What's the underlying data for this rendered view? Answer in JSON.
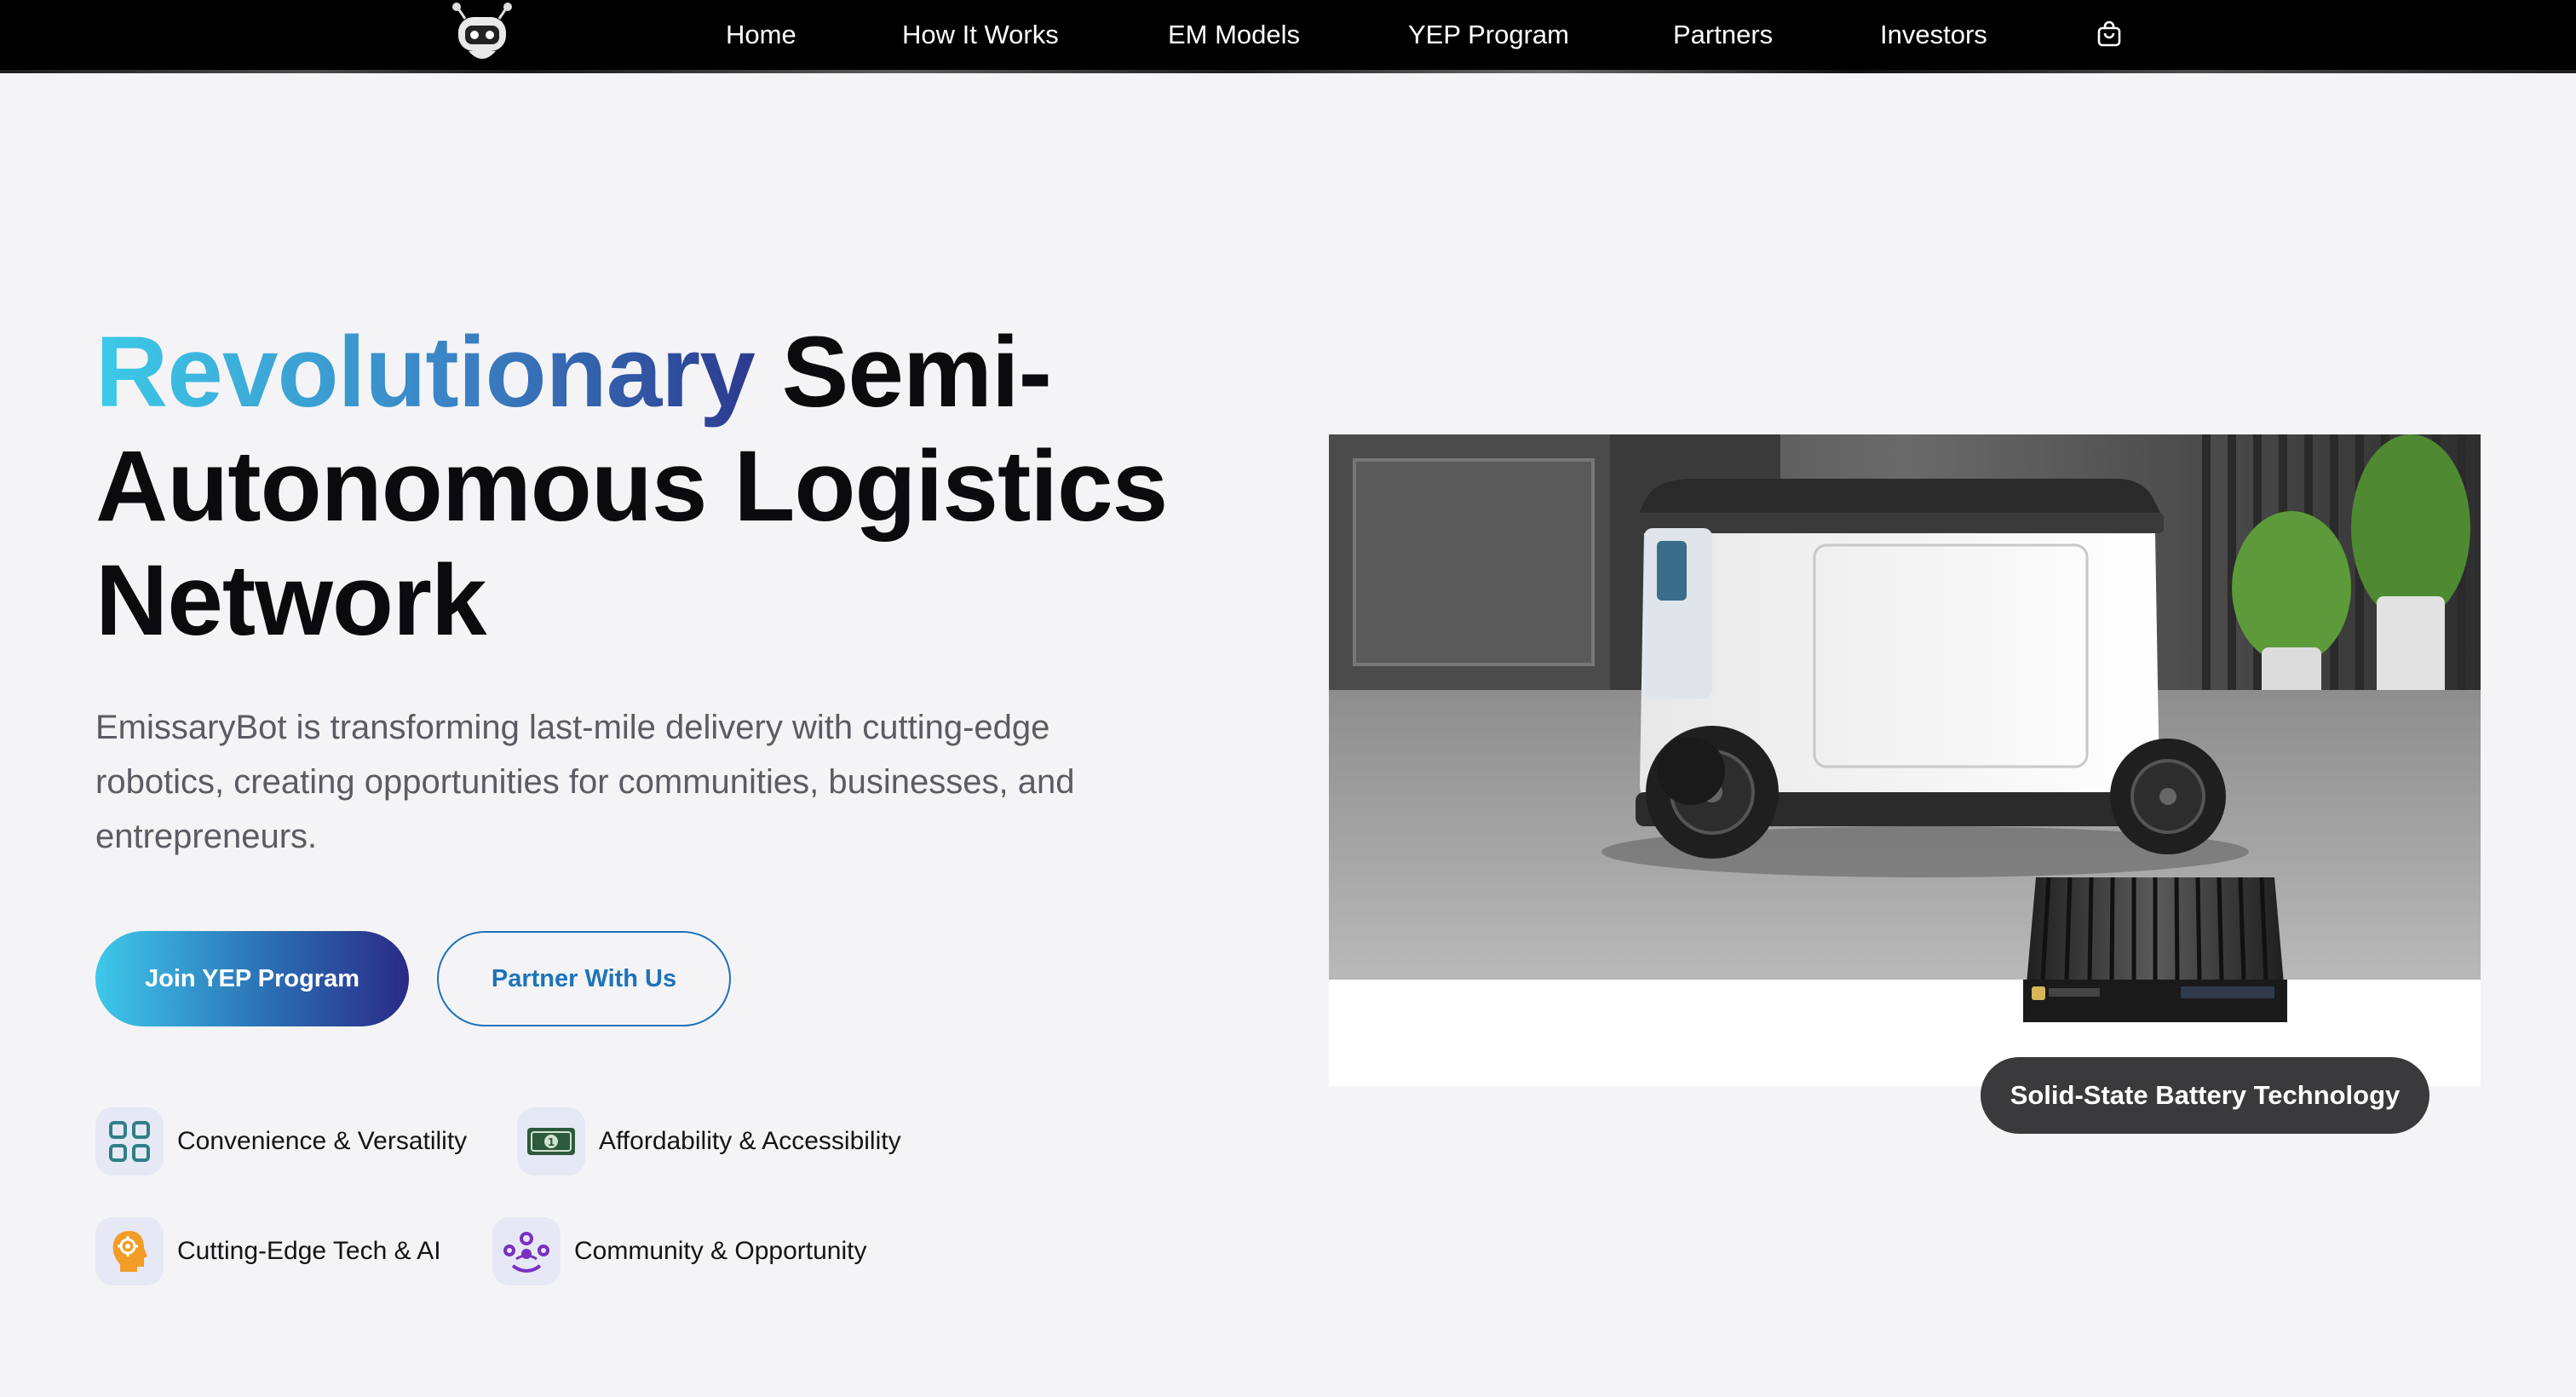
{
  "nav": {
    "links": [
      "Home",
      "How It Works",
      "EM Models",
      "YEP Program",
      "Partners",
      "Investors"
    ]
  },
  "hero": {
    "title_highlight": "Revolutionary",
    "title_rest": "Semi-Autonomous Logistics Network",
    "description": "EmissaryBot is transforming last-mile delivery with cutting-edge robotics, creating opportunities for communities, businesses, and entrepreneurs.",
    "primary_button": "Join YEP Program",
    "secondary_button": "Partner With Us"
  },
  "features": [
    {
      "label": "Convenience & Versatility",
      "icon": "grid-icon"
    },
    {
      "label": "Affordability & Accessibility",
      "icon": "money-icon"
    },
    {
      "label": "Cutting-Edge Tech & AI",
      "icon": "ai-head-icon"
    },
    {
      "label": "Community & Opportunity",
      "icon": "community-icon"
    }
  ],
  "image_badge": "Solid-State Battery Technology",
  "colors": {
    "nav_bg": "#000000",
    "accent_cyan": "#3ec8ea",
    "accent_navy": "#2a2a86",
    "link_blue": "#1e73b8",
    "badge_bg": "#3a3a3c"
  }
}
